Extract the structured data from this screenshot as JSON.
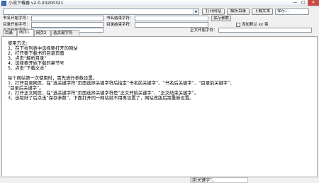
{
  "window": {
    "title": "小说下载器 v2.0.20200321",
    "minimize_glyph": "—",
    "maximize_glyph": "□",
    "close_glyph": "✕"
  },
  "toolbar": {
    "url_value": "",
    "dropdown_arrow": "▼",
    "open_site_button": "打开网站",
    "parse_toc_button": "解析目录",
    "download_button": "下载文本",
    "save_to_field": "保存..."
  },
  "keyword_row1": {
    "book_start_label": "书名开始字符：",
    "book_start_value": "",
    "book_end_label": "书名结束字符：",
    "book_end_value": "",
    "save_params_button": "保存参数"
  },
  "keyword_row2": {
    "toc_start_label": "目录开始字符：",
    "toc_start_value": "",
    "toc_end_label": "目录结束字符：",
    "toc_end_value": "",
    "add_checkbox_label": "添加默认 xx 章"
  },
  "keyword_row3": {
    "body_start_label": "正文开始字符：",
    "body_start_value": "",
    "body_end_label": "正文开始字符：",
    "body_end_value": ""
  },
  "tabs": [
    {
      "label": "目录"
    },
    {
      "label": "网页1"
    },
    {
      "label": "网页2"
    },
    {
      "label": "选关键字符"
    }
  ],
  "help_text": {
    "lines": [
      "使用方法：",
      "1、在下拉列表中选择要打开的网站",
      "2、打开要下载书的目录页面",
      "3、点击“解析目录”",
      "4、选择要开始下载的章节号",
      "5、点击“下载文本”",
      "",
      "每个网站第一次使用时，需先进行参数设置。",
      "1、打开目录网页，在“选关键字符”页面选择关键字符后指定“书名前关键字”、“书名后关键字”、“目录前关键字”、",
      "    “目录后关键字”。",
      "2、打开正文网页，在“选关键字符”页面选择关键字符是“正文开始关键字”、“正文结束关键字”。",
      "3、选取好了后点击“保存参数”，下面打开同一网站就不用再设置了，网站改版后需重新设置。"
    ]
  },
  "status": {
    "tail_text": "|前关键字”、"
  }
}
